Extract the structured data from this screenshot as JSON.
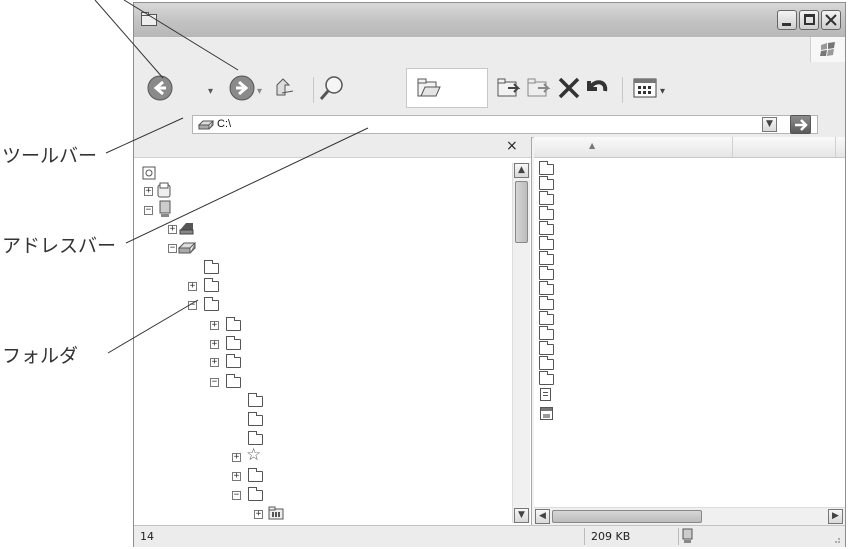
{
  "callouts": {
    "toolbar": "ツールバー",
    "addressbar": "アドレスバー",
    "folder": "フォルダ"
  },
  "address": {
    "path": "C:\\"
  },
  "folders_pane": {
    "close_glyph": "×"
  },
  "status": {
    "count": "14",
    "size": "209 KB"
  },
  "icons": [
    "back-icon",
    "forward-icon",
    "up-icon",
    "search-icon",
    "folders-icon",
    "move-to-icon",
    "copy-to-icon",
    "delete-icon",
    "undo-icon",
    "views-icon",
    "go-icon",
    "drive-icon",
    "windows-flag-icon"
  ]
}
